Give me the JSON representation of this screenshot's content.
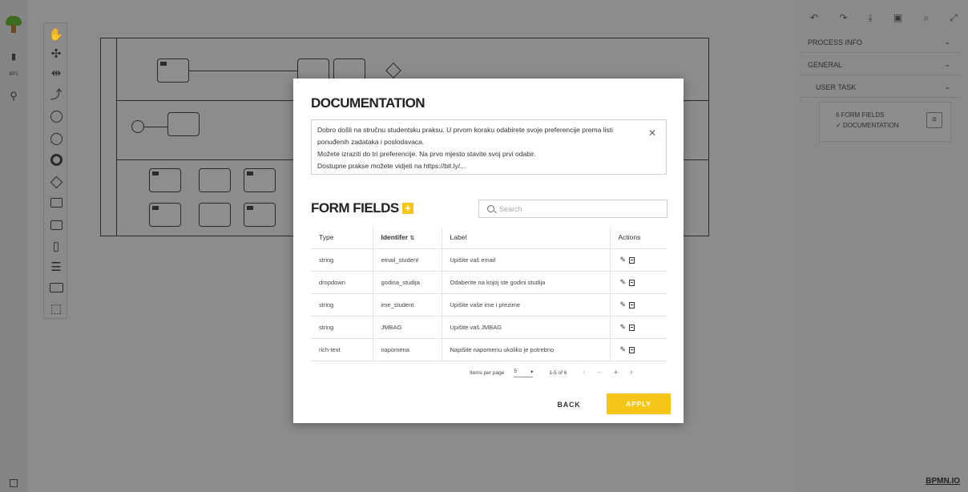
{
  "left_rail": {
    "items": [
      "BP1"
    ]
  },
  "right_panel": {
    "toolbar_icons": [
      "undo-icon",
      "redo-icon",
      "download-icon",
      "save-icon",
      "search-icon",
      "expand-icon"
    ],
    "sections": [
      {
        "label": "PROCESS INFO"
      },
      {
        "label": "GENERAL"
      },
      {
        "label": "USER TASK"
      }
    ],
    "user_task_card": {
      "form_fields": "6  FORM FIELDS",
      "documentation": "✓ DOCUMENTATION"
    },
    "brand": "BPMN.IO"
  },
  "modal": {
    "doc_title": "DOCUMENTATION",
    "doc_lines": [
      "Dobro došli na stručnu studentsku praksu. U prvom koraku odabirete svoje preferencije prema listi",
      "ponuđenih zadataka i poslodavaca.",
      "Možete izraziti do tri preferencije. Na prvo mjesto stavite svoj prvi odabir.",
      "Dostupne prakse možete vidjeti na https://bit.ly/..."
    ],
    "close_symbol": "✕",
    "ff_title": "FORM FIELDS",
    "add_symbol": "+",
    "search": {
      "placeholder": "Search"
    },
    "table": {
      "headers": {
        "type": "Type",
        "identifier": "Identifer",
        "label": "Label",
        "actions": "Actions"
      },
      "rows": [
        {
          "type": "string",
          "identifier": "email_student",
          "label": "Upišite vaš email"
        },
        {
          "type": "dropdown",
          "identifier": "godina_studija",
          "label": "Odaberite na kojoj ste godini studija"
        },
        {
          "type": "string",
          "identifier": "ime_student",
          "label": "Upišite vaše ime i prezime"
        },
        {
          "type": "string",
          "identifier": "JMBAG",
          "label": "Upišite vaš JMBAG"
        },
        {
          "type": "rich-text",
          "identifier": "napomena",
          "label": "Napišite napomenu ukoliko je potrebno"
        }
      ]
    },
    "pager": {
      "items_per_page_label": "Items per page",
      "items_per_page_value": "5",
      "range": "1-5 of 6"
    },
    "buttons": {
      "back": "BACK",
      "apply": "APPLY"
    }
  }
}
